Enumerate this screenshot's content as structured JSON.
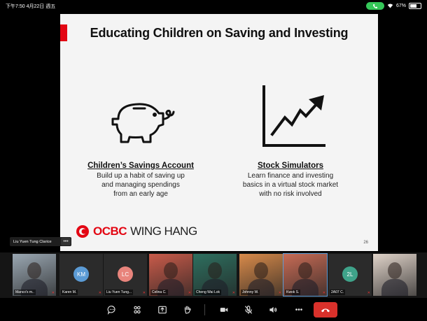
{
  "status_bar": {
    "time": "下午7:50  4月22日 週五",
    "battery": "67%",
    "battery_level": 0.67
  },
  "slide": {
    "title": "Educating Children on Saving and Investing",
    "left_feature": {
      "title": "Children’s Savings Account",
      "desc": [
        "Build up a habit of saving up",
        "and managing spendings",
        "from an early age"
      ]
    },
    "right_feature": {
      "title": "Stock Simulators",
      "desc": [
        "Learn finance and investing",
        "basics in a virtual stock market",
        "with no risk involved"
      ]
    },
    "logo_ocbc": "OCBC",
    "logo_wh": "WING HANG",
    "page_number": "26",
    "icons": {
      "left": "piggy-bank-icon",
      "right": "stock-chart-icon"
    }
  },
  "active_speaker": {
    "name": "Liu Yuen Tung Clarice",
    "more": "•••"
  },
  "participants": [
    {
      "name": "Manco's m..",
      "type": "video",
      "bg": "#9aa7b2"
    },
    {
      "name": "Karen M.",
      "type": "avatar",
      "initials": "KM",
      "color": "#5b9bd5"
    },
    {
      "name": "Liu Yuen Tung...",
      "type": "avatar",
      "initials": "LC",
      "color": "#e8847c"
    },
    {
      "name": "Celina C.",
      "type": "video",
      "bg": "#c95b4a"
    },
    {
      "name": "Cheng Wai Lok",
      "type": "video",
      "bg": "#2e6f5f"
    },
    {
      "name": "Johnny W.",
      "type": "video",
      "bg": "#d88a4a"
    },
    {
      "name": "Kwok S.",
      "type": "video",
      "bg": "#c76b55",
      "active": true
    },
    {
      "name": "2A07 C.",
      "type": "avatar",
      "initials": "2L",
      "color": "#3fa38a"
    },
    {
      "name": "",
      "type": "video",
      "bg": "#e0d3c9"
    }
  ],
  "toolbar": {
    "items": [
      "chat-icon",
      "participants-icon",
      "share-screen-icon",
      "raise-hand-icon",
      "video-icon",
      "mic-muted-icon",
      "speaker-icon",
      "more-icon",
      "end-call-icon"
    ],
    "more": "•••"
  },
  "colors": {
    "brand_red": "#e30613",
    "end_call": "#d9312b",
    "call_pill": "#35c759"
  }
}
